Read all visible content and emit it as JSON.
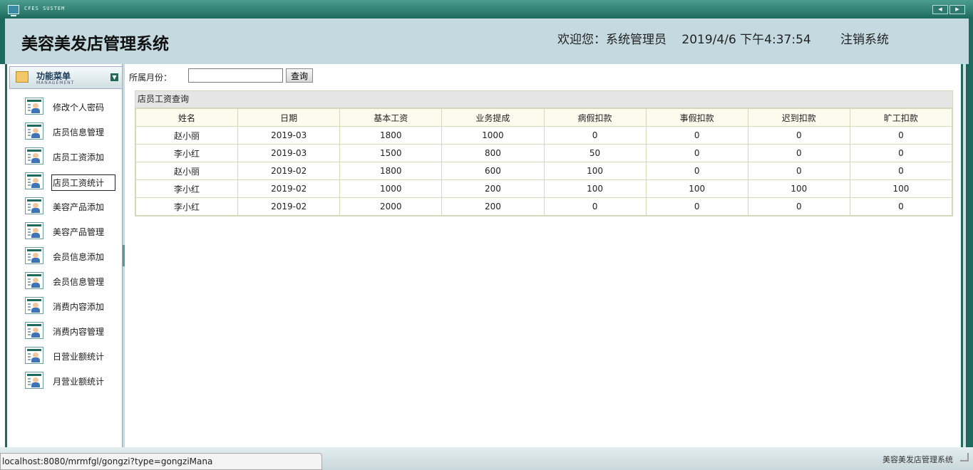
{
  "window": {
    "system_label": "CFES SUSTEM"
  },
  "header": {
    "app_title": "美容美发店管理系统",
    "welcome": "欢迎您：系统管理员",
    "datetime": "2019/4/6 下午4:37:54",
    "logout": "注销系统"
  },
  "sidebar": {
    "title": "功能菜单",
    "subtitle": "MANAGEMENT",
    "items": [
      {
        "label": "修改个人密码"
      },
      {
        "label": "店员信息管理"
      },
      {
        "label": "店员工资添加"
      },
      {
        "label": "店员工资统计"
      },
      {
        "label": "美容产品添加"
      },
      {
        "label": "美容产品管理"
      },
      {
        "label": "会员信息添加"
      },
      {
        "label": "会员信息管理"
      },
      {
        "label": "消费内容添加"
      },
      {
        "label": "消费内容管理"
      },
      {
        "label": "日营业额统计"
      },
      {
        "label": "月营业额统计"
      }
    ]
  },
  "search": {
    "label": "所属月份：",
    "value": "",
    "button": "查询"
  },
  "panel": {
    "title": "店员工资查询"
  },
  "table": {
    "headers": [
      "姓名",
      "日期",
      "基本工资",
      "业务提成",
      "病假扣款",
      "事假扣款",
      "迟到扣款",
      "旷工扣款"
    ],
    "rows": [
      [
        "赵小丽",
        "2019-03",
        "1800",
        "1000",
        "0",
        "0",
        "0",
        "0"
      ],
      [
        "李小红",
        "2019-03",
        "1500",
        "800",
        "50",
        "0",
        "0",
        "0"
      ],
      [
        "赵小丽",
        "2019-02",
        "1800",
        "600",
        "100",
        "0",
        "0",
        "0"
      ],
      [
        "李小红",
        "2019-02",
        "1000",
        "200",
        "100",
        "100",
        "100",
        "100"
      ],
      [
        "李小红",
        "2019-02",
        "2000",
        "200",
        "0",
        "0",
        "0",
        "0"
      ]
    ]
  },
  "statusbar": {
    "url": "localhost:8080/mrmfgl/gongzi?type=gongziMana"
  },
  "footer": {
    "title": "美容美发店管理系统"
  },
  "colors": {
    "frame": "#1d6a5c",
    "header_bg": "#c4dae0",
    "table_border": "#d6d6b9"
  }
}
